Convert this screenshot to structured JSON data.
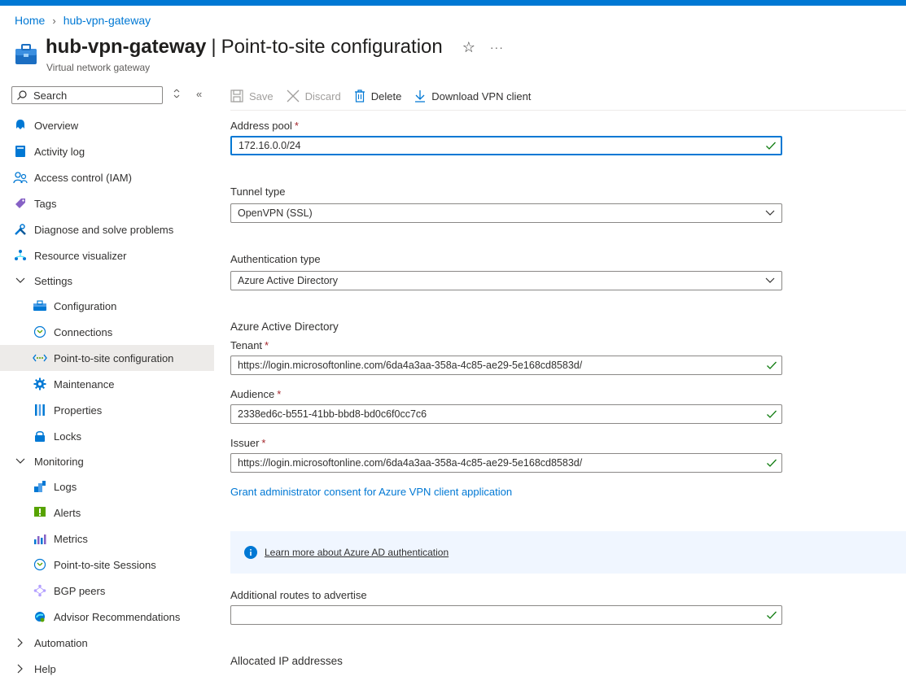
{
  "breadcrumb": {
    "home": "Home",
    "current": "hub-vpn-gateway"
  },
  "header": {
    "resource_name": "hub-vpn-gateway",
    "separator": "|",
    "page": "Point-to-site configuration",
    "subtitle": "Virtual network gateway",
    "star": "☆",
    "more": "···"
  },
  "search": {
    "placeholder": "Search"
  },
  "sidebar": {
    "items": [
      {
        "label": "Overview"
      },
      {
        "label": "Activity log"
      },
      {
        "label": "Access control (IAM)"
      },
      {
        "label": "Tags"
      },
      {
        "label": "Diagnose and solve problems"
      },
      {
        "label": "Resource visualizer"
      }
    ],
    "settings": {
      "label": "Settings",
      "items": [
        {
          "label": "Configuration"
        },
        {
          "label": "Connections"
        },
        {
          "label": "Point-to-site configuration",
          "active": true
        },
        {
          "label": "Maintenance"
        },
        {
          "label": "Properties"
        },
        {
          "label": "Locks"
        }
      ]
    },
    "monitoring": {
      "label": "Monitoring",
      "items": [
        {
          "label": "Logs"
        },
        {
          "label": "Alerts"
        },
        {
          "label": "Metrics"
        },
        {
          "label": "Point-to-site Sessions"
        },
        {
          "label": "BGP peers"
        },
        {
          "label": "Advisor Recommendations"
        }
      ]
    },
    "automation": {
      "label": "Automation"
    },
    "help": {
      "label": "Help"
    }
  },
  "toolbar": {
    "save": "Save",
    "discard": "Discard",
    "delete": "Delete",
    "download": "Download VPN client"
  },
  "form": {
    "address_pool": {
      "label": "Address pool",
      "value": "172.16.0.0/24"
    },
    "tunnel_type": {
      "label": "Tunnel type",
      "value": "OpenVPN (SSL)"
    },
    "auth_type": {
      "label": "Authentication type",
      "value": "Azure Active Directory"
    },
    "aad_section": "Azure Active Directory",
    "tenant": {
      "label": "Tenant",
      "value": "https://login.microsoftonline.com/6da4a3aa-358a-4c85-ae29-5e168cd8583d/"
    },
    "audience": {
      "label": "Audience",
      "value": "2338ed6c-b551-41bb-bbd8-bd0c6f0cc7c6"
    },
    "issuer": {
      "label": "Issuer",
      "value": "https://login.microsoftonline.com/6da4a3aa-358a-4c85-ae29-5e168cd8583d/"
    },
    "consent_link": "Grant administrator consent for Azure VPN client application",
    "info_link": "Learn more about Azure AD authentication",
    "additional_routes": {
      "label": "Additional routes to advertise",
      "value": ""
    },
    "allocated_ips": "Allocated IP addresses",
    "required_mark": "*"
  },
  "colors": {
    "accent": "#0078d4",
    "active_bg": "#edebe9",
    "valid": "#107c10",
    "required": "#a4262c",
    "info_bg": "#f0f6ff"
  }
}
